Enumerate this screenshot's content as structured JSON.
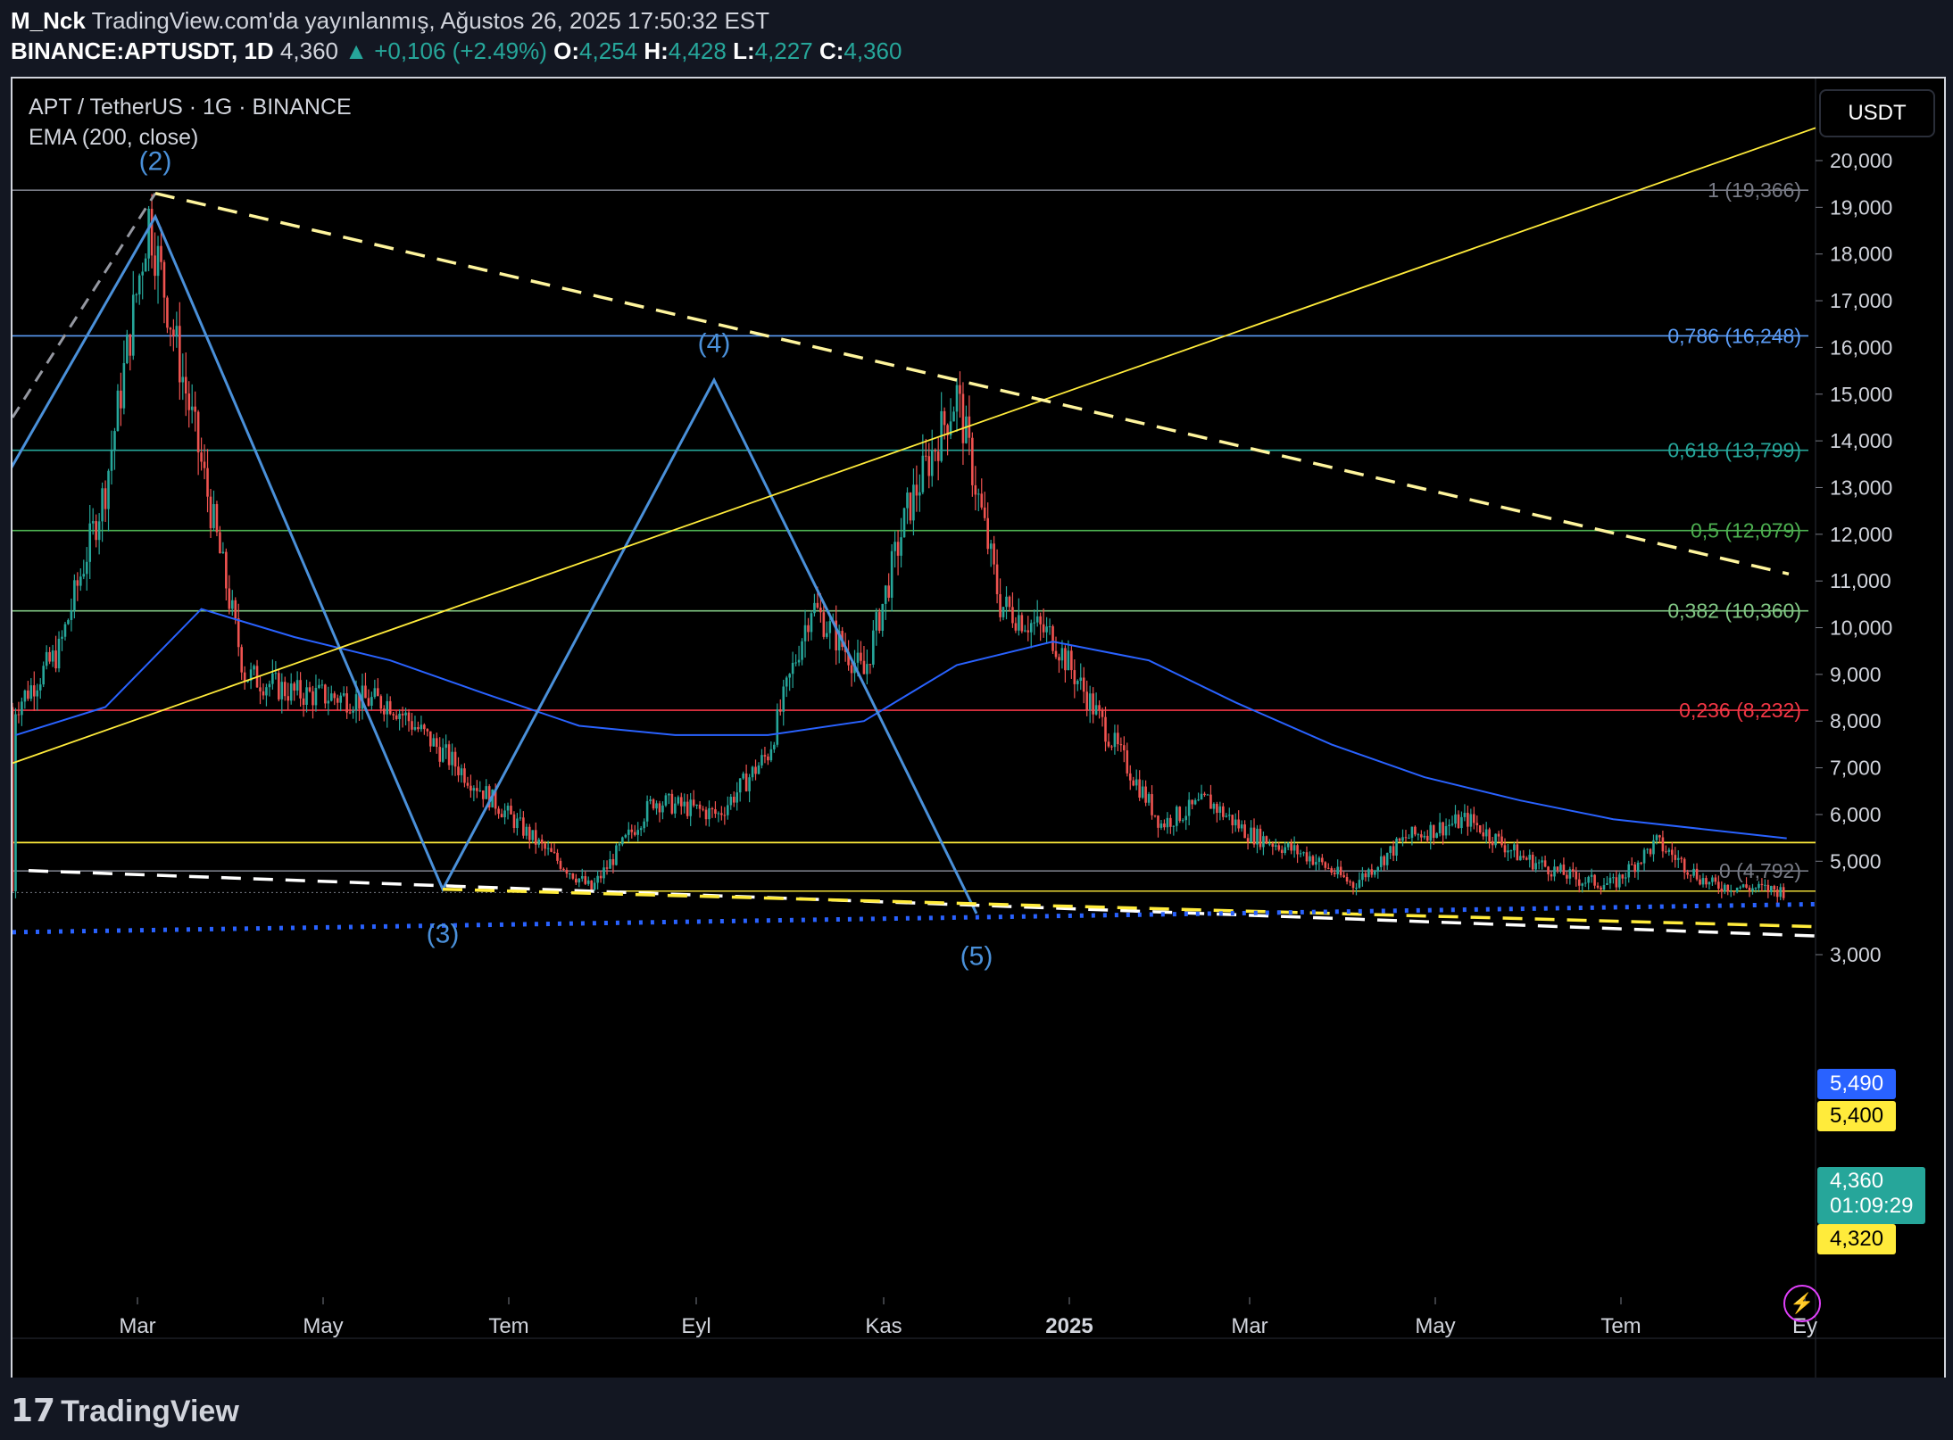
{
  "header": {
    "author": "M_Nck",
    "published": "TradingView.com'da yayınlanmış, Ağustos 26, 2025 17:50:32 EST",
    "symbol": "BINANCE:APTUSDT, 1D",
    "last": "4,360",
    "change": "▲ +0,106 (+2.49%)",
    "o_label": "O:",
    "o": "4,254",
    "h_label": "H:",
    "h": "4,428",
    "l_label": "L:",
    "l": "4,227",
    "c_label": "C:",
    "c": "4,360"
  },
  "legend": {
    "title": "APT / TetherUS · 1G · BINANCE",
    "indicator": "EMA (200, close)"
  },
  "currency": "USDT",
  "price_axis": {
    "ticks": [
      "20,000",
      "19,000",
      "18,000",
      "17,000",
      "16,000",
      "15,000",
      "14,000",
      "13,000",
      "12,000",
      "11,000",
      "10,000",
      "9,000",
      "8,000",
      "7,000",
      "6,000",
      "5,000",
      "3,000"
    ],
    "tags": {
      "ema": "5,490",
      "level": "5,400",
      "current": "4,360",
      "countdown": "01:09:29",
      "support": "4,320"
    }
  },
  "time_axis": [
    "Mar",
    "May",
    "Tem",
    "Eyl",
    "Kas",
    "2025",
    "Mar",
    "May",
    "Tem",
    "Ey"
  ],
  "fib_levels": [
    {
      "label": "1 (19,366)",
      "color": "#787b86"
    },
    {
      "label": "0,786 (16,248)",
      "color": "#5b9cf6"
    },
    {
      "label": "0,618 (13,799)",
      "color": "#26a69a"
    },
    {
      "label": "0,5 (12,079)",
      "color": "#4caf50"
    },
    {
      "label": "0,382 (10,360)",
      "color": "#81c784"
    },
    {
      "label": "0,236 (8,232)",
      "color": "#f23645"
    },
    {
      "label": "0 (4,792)",
      "color": "#787b86"
    }
  ],
  "waves": [
    "(2)",
    "(3)",
    "(4)",
    "(5)"
  ],
  "chart_data": {
    "type": "candlestick",
    "title": "APT / TetherUS · 1G · BINANCE",
    "indicator": "EMA (200, close)",
    "ylim": [
      2700,
      20700
    ],
    "x_ticks": [
      "Mar",
      "May",
      "Tem",
      "Eyl",
      "Kas",
      "2025",
      "Mar",
      "May",
      "Tem",
      "Ey"
    ],
    "series": [
      {
        "name": "APT / TetherUS",
        "values": [
          [
            "2024-02-01",
            8300
          ],
          [
            "2024-02-15",
            9500
          ],
          [
            "2024-03-01",
            13000
          ],
          [
            "2024-03-15",
            18800
          ],
          [
            "2024-04-01",
            13500
          ],
          [
            "2024-04-15",
            9000
          ],
          [
            "2024-05-01",
            8600
          ],
          [
            "2024-06-01",
            8400
          ],
          [
            "2024-07-01",
            6500
          ],
          [
            "2024-07-20",
            5300
          ],
          [
            "2024-08-05",
            4400
          ],
          [
            "2024-08-25",
            6300
          ],
          [
            "2024-09-15",
            6000
          ],
          [
            "2024-10-01",
            7300
          ],
          [
            "2024-10-15",
            10500
          ],
          [
            "2024-11-01",
            9000
          ],
          [
            "2024-11-15",
            12500
          ],
          [
            "2024-12-01",
            15000
          ],
          [
            "2024-12-15",
            10500
          ],
          [
            "2025-01-01",
            9800
          ],
          [
            "2025-01-20",
            7600
          ],
          [
            "2025-02-05",
            5800
          ],
          [
            "2025-02-20",
            6300
          ],
          [
            "2025-03-05",
            5600
          ],
          [
            "2025-03-25",
            5100
          ],
          [
            "2025-04-08",
            4500
          ],
          [
            "2025-04-25",
            5500
          ],
          [
            "2025-05-15",
            5900
          ],
          [
            "2025-06-01",
            5100
          ],
          [
            "2025-06-20",
            4600
          ],
          [
            "2025-07-01",
            4500
          ],
          [
            "2025-07-15",
            5400
          ],
          [
            "2025-08-01",
            4500
          ],
          [
            "2025-08-26",
            4360
          ]
        ]
      },
      {
        "name": "EMA (200, close)",
        "values": [
          [
            "2024-02-01",
            7700
          ],
          [
            "2024-03-01",
            8300
          ],
          [
            "2024-04-01",
            10400
          ],
          [
            "2024-05-01",
            9800
          ],
          [
            "2024-06-01",
            9300
          ],
          [
            "2024-07-01",
            8600
          ],
          [
            "2024-08-01",
            7900
          ],
          [
            "2024-09-01",
            7700
          ],
          [
            "2024-10-01",
            7700
          ],
          [
            "2024-11-01",
            8000
          ],
          [
            "2024-12-01",
            9200
          ],
          [
            "2025-01-01",
            9700
          ],
          [
            "2025-02-01",
            9300
          ],
          [
            "2025-03-01",
            8400
          ],
          [
            "2025-04-01",
            7500
          ],
          [
            "2025-05-01",
            6800
          ],
          [
            "2025-06-01",
            6300
          ],
          [
            "2025-07-01",
            5900
          ],
          [
            "2025-08-26",
            5490
          ]
        ]
      }
    ]
  },
  "footer": {
    "brand": "TradingView"
  },
  "colors": {
    "up": "#26a69a",
    "down": "#ef5350",
    "ema": "#2962ff",
    "wave": "#4a90d9",
    "trend_yellow": "#ffeb3b",
    "dash_white": "#ffffff",
    "dot_blue": "#2962ff"
  }
}
